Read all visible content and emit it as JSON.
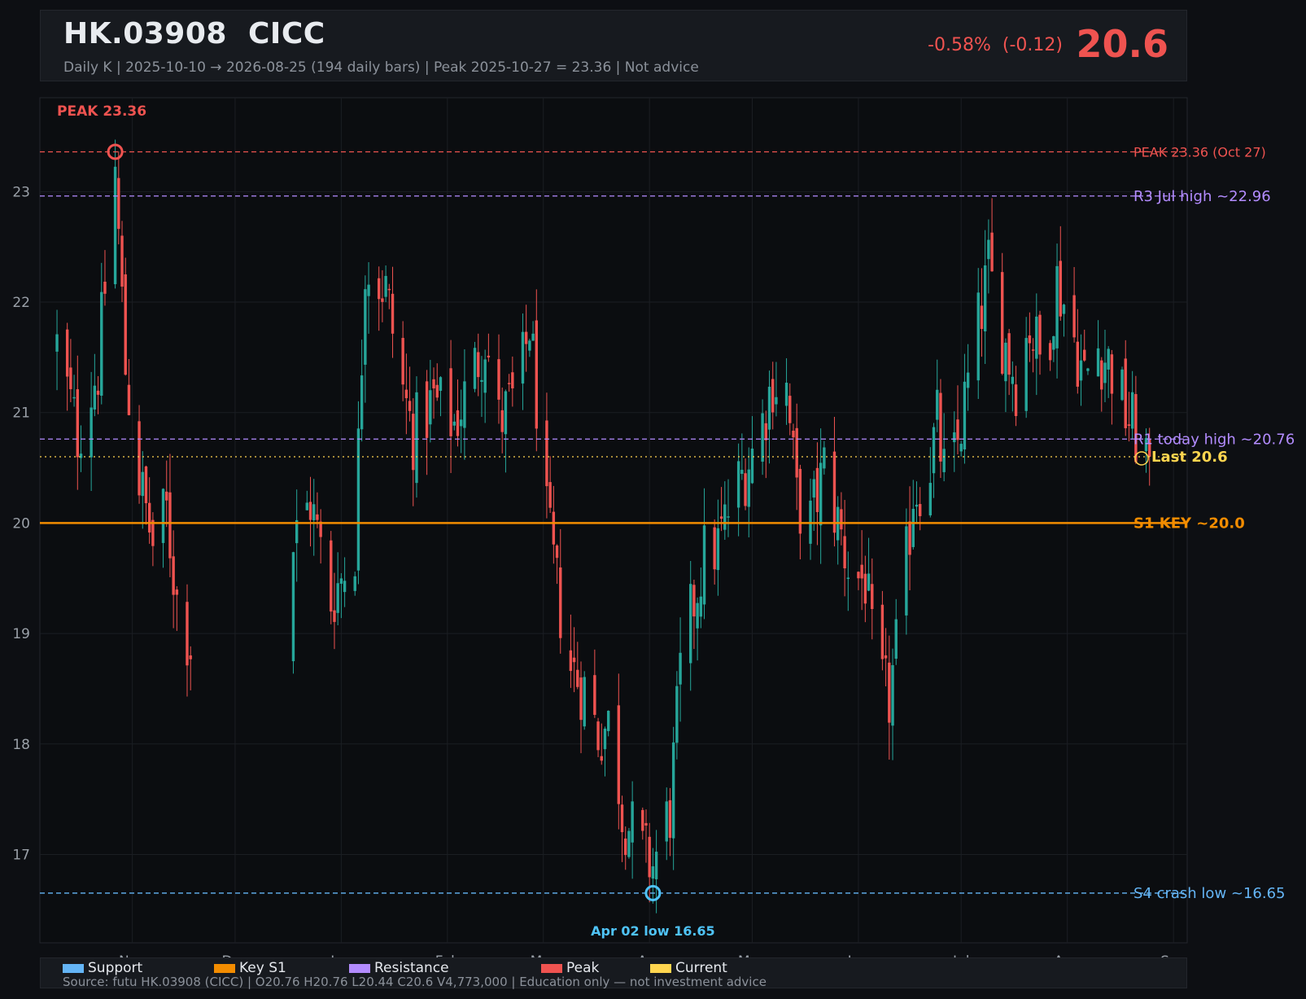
{
  "header": {
    "title": "HK.03908  CICC",
    "subtitle": "Daily K  |  2025-10-10 → 2026-08-25 (194 daily bars)  |  Peak 2025-10-27 = 23.36  |  Not advice",
    "change": "-0.58%  (-0.12)",
    "price": "20.6"
  },
  "colors": {
    "up": "#26a69a",
    "down": "#ef5350",
    "support": "#64b5f6",
    "key": "#f28c00",
    "resistance": "#b38cff",
    "peak": "#ef5350",
    "current": "#ffd54f",
    "background": "#0d0f13",
    "panel": "#171a1f"
  },
  "chart_data": {
    "type": "candlestick",
    "ylim": [
      16.2,
      23.85
    ],
    "yticks": [
      17,
      18,
      19,
      20,
      21,
      22,
      23
    ],
    "xlim": [
      "2025-10-05",
      "2026-09-05"
    ],
    "xticks": [
      {
        "date": "2025-11-01",
        "label": "Nov"
      },
      {
        "date": "2025-12-01",
        "label": "Dec"
      },
      {
        "date": "2026-01-01",
        "label": "Jan"
      },
      {
        "date": "2026-02-01",
        "label": "Feb"
      },
      {
        "date": "2026-03-01",
        "label": "Mar"
      },
      {
        "date": "2026-04-01",
        "label": "Apr"
      },
      {
        "date": "2026-05-01",
        "label": "May"
      },
      {
        "date": "2026-06-01",
        "label": "Jun"
      },
      {
        "date": "2026-07-01",
        "label": "Jul"
      },
      {
        "date": "2026-08-01",
        "label": "Aug"
      },
      {
        "date": "2026-09-01",
        "label": "Sep"
      }
    ],
    "anchors": [
      [
        "2025-10-10",
        21.6
      ],
      [
        "2025-10-16",
        20.8
      ],
      [
        "2025-10-22",
        21.4
      ],
      [
        "2025-10-27",
        23.2
      ],
      [
        "2025-10-30",
        21.4
      ],
      [
        "2025-11-03",
        20.4
      ],
      [
        "2025-11-07",
        19.8
      ],
      [
        "2025-11-11",
        20.1
      ],
      [
        "2025-11-14",
        19.3
      ],
      [
        "2025-11-18",
        18.9
      ],
      [
        "2025-12-18",
        19.8
      ],
      [
        "2025-12-23",
        20.2
      ],
      [
        "2025-12-29",
        19.3
      ],
      [
        "2026-01-05",
        19.8
      ],
      [
        "2026-01-08",
        22.4
      ],
      [
        "2026-01-14",
        22.1
      ],
      [
        "2026-01-19",
        21.2
      ],
      [
        "2026-01-22",
        20.8
      ],
      [
        "2026-01-28",
        21.1
      ],
      [
        "2026-02-03",
        20.9
      ],
      [
        "2026-02-08",
        21.3
      ],
      [
        "2026-02-12",
        21.7
      ],
      [
        "2026-02-16",
        20.9
      ],
      [
        "2026-02-22",
        21.2
      ],
      [
        "2026-02-25",
        21.8
      ],
      [
        "2026-02-28",
        20.8
      ],
      [
        "2026-03-02",
        20.0
      ],
      [
        "2026-03-05",
        19.4
      ],
      [
        "2026-03-09",
        18.7
      ],
      [
        "2026-03-13",
        18.5
      ],
      [
        "2026-03-17",
        18.1
      ],
      [
        "2026-03-21",
        18.2
      ],
      [
        "2026-03-24",
        17.4
      ],
      [
        "2026-03-27",
        17.2
      ],
      [
        "2026-03-30",
        17.0
      ],
      [
        "2026-04-02",
        16.9
      ],
      [
        "2026-04-07",
        17.4
      ],
      [
        "2026-04-10",
        18.6
      ],
      [
        "2026-04-14",
        19.3
      ],
      [
        "2026-04-17",
        19.7
      ],
      [
        "2026-04-21",
        19.8
      ],
      [
        "2026-04-25",
        20.2
      ],
      [
        "2026-04-29",
        20.5
      ],
      [
        "2026-05-03",
        20.8
      ],
      [
        "2026-05-07",
        21.3
      ],
      [
        "2026-05-11",
        21.2
      ],
      [
        "2026-05-14",
        20.2
      ],
      [
        "2026-05-18",
        20.0
      ],
      [
        "2026-05-22",
        20.5
      ],
      [
        "2026-05-26",
        20.0
      ],
      [
        "2026-05-30",
        19.5
      ],
      [
        "2026-06-03",
        19.5
      ],
      [
        "2026-06-06",
        18.6
      ],
      [
        "2026-06-10",
        18.4
      ],
      [
        "2026-06-14",
        19.3
      ],
      [
        "2026-06-17",
        20.3
      ],
      [
        "2026-06-21",
        20.4
      ],
      [
        "2026-06-24",
        20.9
      ],
      [
        "2026-06-27",
        20.2
      ],
      [
        "2026-07-01",
        20.9
      ],
      [
        "2026-07-05",
        21.6
      ],
      [
        "2026-07-09",
        22.3
      ],
      [
        "2026-07-13",
        21.7
      ],
      [
        "2026-07-17",
        21.3
      ],
      [
        "2026-07-21",
        21.8
      ],
      [
        "2026-07-25",
        21.4
      ],
      [
        "2026-07-29",
        22.2
      ],
      [
        "2026-08-02",
        21.8
      ],
      [
        "2026-08-06",
        21.3
      ],
      [
        "2026-08-10",
        21.6
      ],
      [
        "2026-08-14",
        21.4
      ],
      [
        "2026-08-18",
        21.0
      ],
      [
        "2026-08-21",
        20.8
      ],
      [
        "2026-08-25",
        20.6
      ]
    ],
    "levels": [
      {
        "value": 23.36,
        "label": "PEAK 23.36 (Oct 27)",
        "kind": "peak",
        "style": "dashed"
      },
      {
        "value": 22.96,
        "label": "R3 Jul high ~22.96",
        "kind": "resistance",
        "style": "dashed"
      },
      {
        "value": 20.76,
        "label": "R1 today high ~20.76",
        "kind": "resistance",
        "style": "dashed"
      },
      {
        "value": 20.6,
        "label": "Last 20.6",
        "kind": "current",
        "style": "dotted"
      },
      {
        "value": 20.0,
        "label": "S1 KEY ~20.0",
        "kind": "key",
        "style": "solid"
      },
      {
        "value": 16.65,
        "label": "S4 crash low ~16.65",
        "kind": "support",
        "style": "dashed"
      }
    ],
    "peak_marker": {
      "date": "2025-10-27",
      "value": 23.36,
      "label": "PEAK 23.36"
    },
    "low_marker": {
      "date": "2026-04-02",
      "value": 16.65,
      "label": "Apr 02 low 16.65"
    },
    "grid": true
  },
  "legend": {
    "items": [
      {
        "label": "Support",
        "color": "#64b5f6"
      },
      {
        "label": "Key S1",
        "color": "#f28c00"
      },
      {
        "label": "Resistance",
        "color": "#b38cff"
      },
      {
        "label": "Peak",
        "color": "#ef5350"
      },
      {
        "label": "Current",
        "color": "#ffd54f"
      }
    ],
    "source": "Source: futu HK.03908 (CICC)  |  O20.76  H20.76  L20.44  C20.6  V4,773,000  |  Education only — not investment advice"
  }
}
